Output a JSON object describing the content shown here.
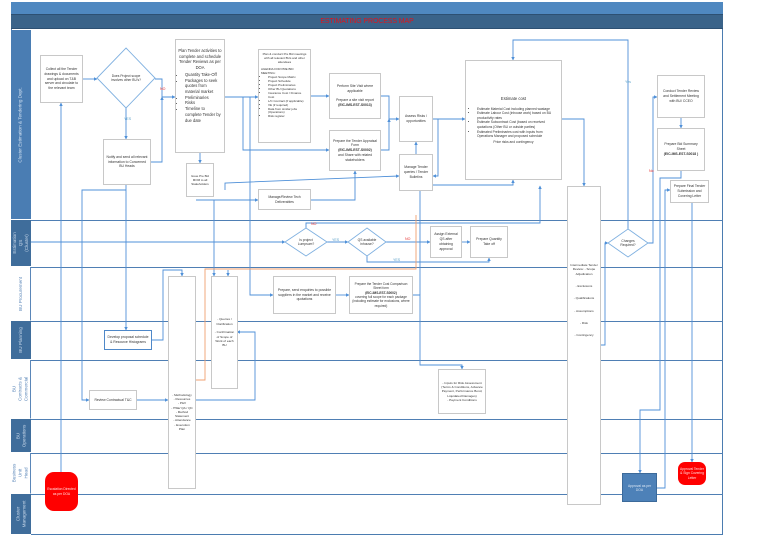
{
  "title": "ESTIMATING PROCESS MAP",
  "lanes": [
    "Cluster Estimation & Tendering Dept.",
    "Estimation QS (Cluster)",
    "BU Procurement",
    "BU Planning",
    "BU Contracts & Commercial",
    "BU Operations",
    "Business Unit Head",
    "Cluster Management"
  ],
  "labels": {
    "no": "NO",
    "yes": "YES",
    "yes_lc": "Yes",
    "no_lc": "No"
  },
  "nodes": {
    "collect": "Collect all the Tender drawings & documents and upload on T&B server and circulate to the relevant team",
    "scope_decision": "Does Project scope involves other BU's?",
    "notify": "Notify and send all relevant information to Concerned BU Heads",
    "plan": {
      "heading": "Plan Tender activities to complete and schedule Tender Reviews as per DOA",
      "bullets": [
        "Quantity Take-Off",
        "Packages to seek quotes from material market",
        "Preliminaries",
        "Risks",
        "Timeline to complete Tender by due date"
      ]
    },
    "issue_mom": "Issue Pre Bid MOM to all Stakeholders",
    "prebid": {
      "heading": "Plan & conduct Pre Bid meetings with all relevant BUs and other attendees",
      "agenda": "AGENDA FOR PRE BID MEETING:",
      "bullets": [
        "Project Scope Matrix",
        "Project Schedule",
        "Project Preliminaries",
        "Other BU Quotations",
        "Insurance Cost / Finance Cost",
        "L/C Contract (if applicable)",
        "VE (if required)",
        "Data from similar jobs (Operations)",
        "Risk register"
      ]
    },
    "site_visit": {
      "line1": "Perform Site Visit where applicable",
      "line2": "Prepare a site visit report",
      "code": "(EIC-IMS-EST-S0013)"
    },
    "appraisal": {
      "line1": "Prepare the Tender Appraisal Form",
      "code": "(EIC-IMS-EST-S0002)",
      "line2": "and Share with related stakeholders"
    },
    "assess_risks": "Assess Risks / opportunities",
    "manage_queries": "Manage Tender queries / Tender Bulletins",
    "estimate": {
      "heading": "Estimate cost",
      "bullets": [
        "Estimate Material Cost including planned wastage",
        "Estimate Labour Cost (inhouse work) based on BU productivity rates",
        "Estimate Subcontract Cost (based on received quotations (Other BU or outside parties)",
        "Estimated Preliminaries cost with inputs from Operations Manager and proposed schedule"
      ],
      "tail": "Price risks and contingency"
    },
    "tech_deliverables": "Manage/Review Tech Deliverables",
    "conduct_review": "Conduct Tender Review and Settlement Meeting with BU/ CCEO",
    "bid_summary": {
      "line1": "Prepare Bid Summary Sheet",
      "code": "(EIC-IMS-EST-S0018 )"
    },
    "final_submission": "Prepare Final Tender Submission and Covering Letter",
    "changes_decision": "Changes Required?",
    "lumpsum_decision": "Is project Lumpsum?",
    "qs_decision": "QS available inhouse?",
    "assign_qs": "Assign External QS after obtaining approval",
    "prepare_qto": "Prepare Quantity Take off",
    "enquiries": "Prepare, send enquiries to possible suppliers in the market and receive quotations",
    "cost_comparison": {
      "line1": "Prepare the Tender Cost Comparison Sheet form",
      "code": "(EIC-IMS-EST-S0002)",
      "line2": "covering full scope for each package (including estimate for exclusions, where required)"
    },
    "develop_schedule": "Develop proposal schedule & Resource Histograms",
    "methodology": [
      "- Methodology",
      "- Resources",
      "- P&V",
      "- HSE/ QA / QC",
      "- Method Statement",
      "- Attendance",
      "- Execution Plan"
    ],
    "queries_clarification": [
      "- Queries / Clarification",
      "- Confirmation of Scope of Work of each BU"
    ],
    "review_tc": "Review Contractual T&C",
    "risk_inputs": [
      "- Inputs for Risk Assessment (Terms & Conditions, Advance Payment, Performance Bond, Liquidated Damages)",
      "- Payment Conditions"
    ],
    "intermediate_review": [
      "Intermediate Tender Review: - Scope Adjudication",
      "- Exclusions",
      "- Qualifications",
      "- Assumptions",
      "- Risk",
      "- Contingency"
    ],
    "escalation": "Escalation Directed as per DOA",
    "approval_doa": "Approval as per DOA",
    "approve_tender": "Approval Tender & Sign Covering Letter"
  },
  "colors": {
    "connector": "#4f90d8",
    "highlight": "#f0a070",
    "terminator": "#ff0000",
    "approval": "#4d81b8",
    "title": "#e0141a"
  }
}
